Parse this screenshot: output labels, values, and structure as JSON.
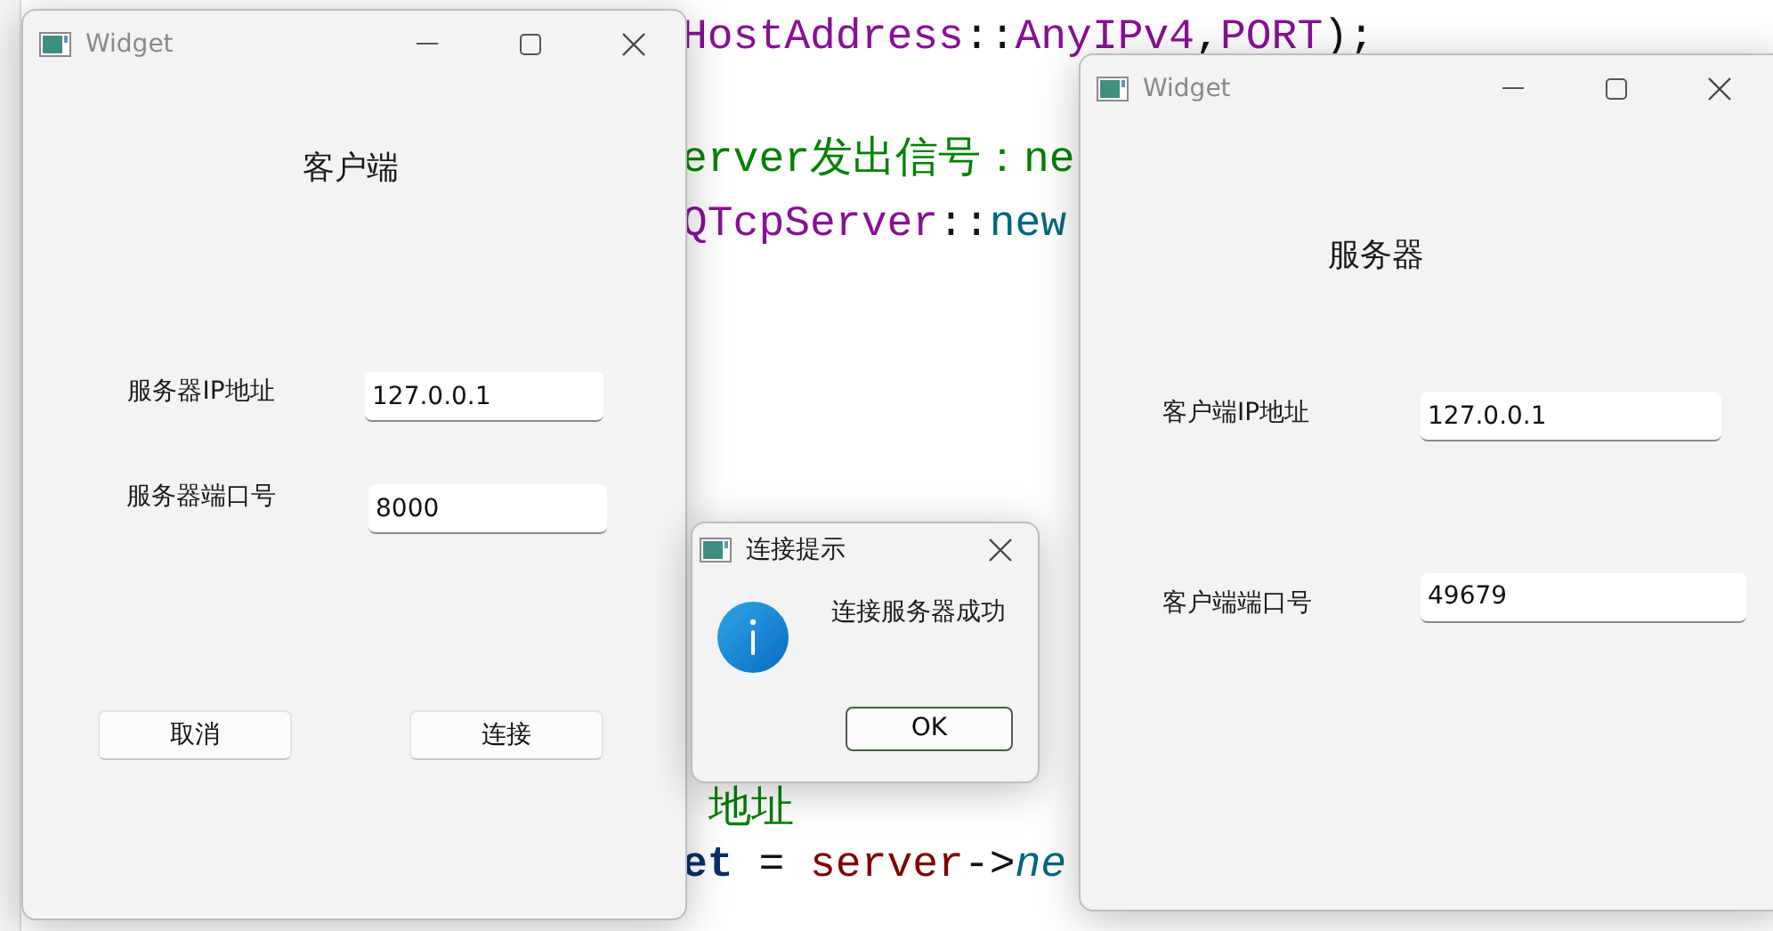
{
  "editor": {
    "lines": [
      {
        "tokens": [
          {
            "text": "HostAddress",
            "kind": "type"
          },
          {
            "text": "::",
            "kind": "plain"
          },
          {
            "text": "AnyIPv4",
            "kind": "type"
          },
          {
            "text": ",",
            "kind": "plain"
          },
          {
            "text": "PORT",
            "kind": "type"
          },
          {
            "text": ");",
            "kind": "plain"
          }
        ]
      },
      {
        "tokens": [
          {
            "text": "erver发出信号：ne",
            "kind": "comment"
          }
        ]
      },
      {
        "tokens": [
          {
            "text": "QTcpServer",
            "kind": "type"
          },
          {
            "text": "::",
            "kind": "plain"
          },
          {
            "text": "new",
            "kind": "method"
          }
        ]
      },
      {
        "tokens": [
          {
            "text": "地址",
            "kind": "comment"
          }
        ]
      },
      {
        "tokens": [
          {
            "text": "et",
            "kind": "keyword"
          },
          {
            "text": " = ",
            "kind": "plain"
          },
          {
            "text": "server",
            "kind": "variable"
          },
          {
            "text": "->",
            "kind": "plain"
          },
          {
            "text": "ne",
            "kind": "call"
          }
        ]
      }
    ]
  },
  "windows": [
    {
      "kind": "client",
      "title": "Widget",
      "heading": "客户端",
      "fields": [
        {
          "label": "服务器IP地址",
          "value": "127.0.0.1"
        },
        {
          "label": "服务器端口号",
          "value": "8000"
        }
      ],
      "buttons": [
        "取消",
        "连接"
      ]
    },
    {
      "kind": "server",
      "title": "Widget",
      "heading": "服务器",
      "fields": [
        {
          "label": "客户端IP地址",
          "value": "127.0.0.1"
        },
        {
          "label": "客户端端口号",
          "value": "49679"
        }
      ]
    }
  ],
  "dialog": {
    "title": "连接提示",
    "message": "连接服务器成功",
    "button": "OK"
  }
}
